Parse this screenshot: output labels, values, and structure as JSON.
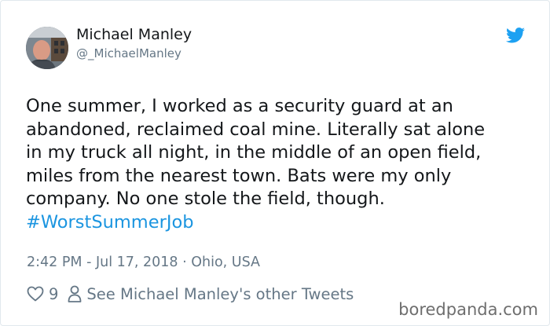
{
  "user": {
    "name": "Michael Manley",
    "handle": "@_MichaelManley"
  },
  "tweet": {
    "lines": [
      "One summer, I worked as a security guard at an",
      "abandoned, reclaimed coal mine. Literally sat alone",
      "in my truck all night, in the middle of an open field,",
      "miles from the nearest town. Bats were my only",
      "company. No one stole the field, though."
    ],
    "hashtag": "#WorstSummerJob",
    "meta": "2:42 PM - Jul 17, 2018 · Ohio, USA"
  },
  "actions": {
    "likes": "9",
    "other_tweets": "See Michael Manley's other Tweets"
  },
  "watermark": "boredpanda.com",
  "colors": {
    "link": "#1b95e0",
    "twitter_blue": "#1da1f2",
    "secondary_text": "#657786"
  },
  "icons": {
    "brand": "twitter-bird-icon",
    "like": "heart-icon",
    "profile": "person-icon"
  }
}
